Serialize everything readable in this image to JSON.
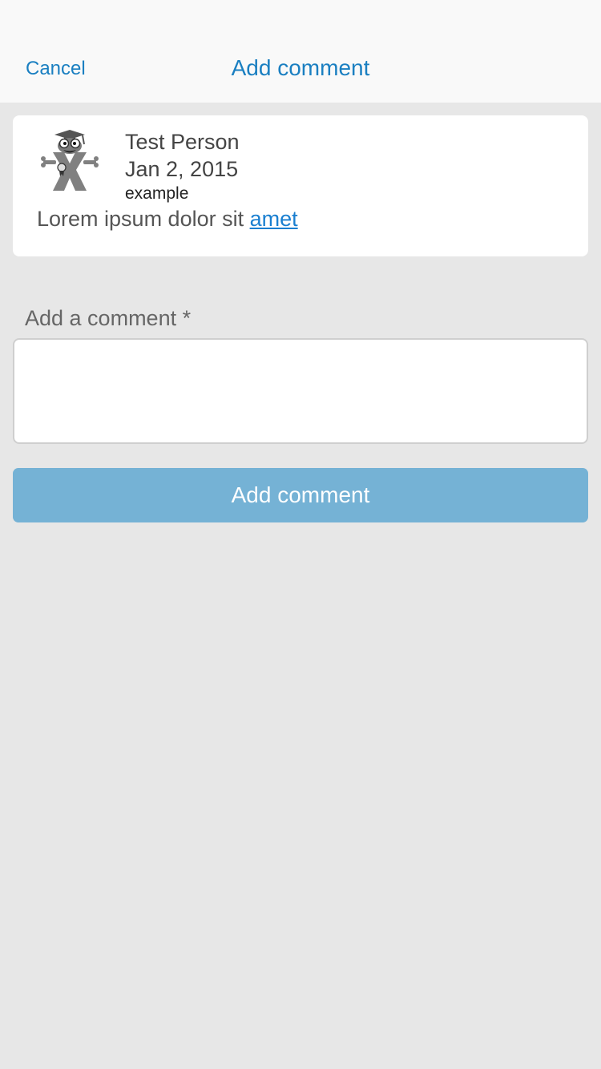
{
  "navbar": {
    "cancel_label": "Cancel",
    "title": "Add comment"
  },
  "post": {
    "avatar_icon": "mascot-x-icon",
    "author": "Test Person",
    "date": "Jan 2, 2015",
    "tag": "example",
    "body_text": "Lorem ipsum dolor sit ",
    "body_link": "amet"
  },
  "comment_form": {
    "label": "Add a comment *",
    "input_value": "",
    "submit_label": "Add comment"
  },
  "colors": {
    "accent": "#1a7fc1",
    "button": "#75b2d5",
    "background": "#e7e7e7",
    "navbar": "#f9f9f9",
    "card": "#ffffff"
  }
}
